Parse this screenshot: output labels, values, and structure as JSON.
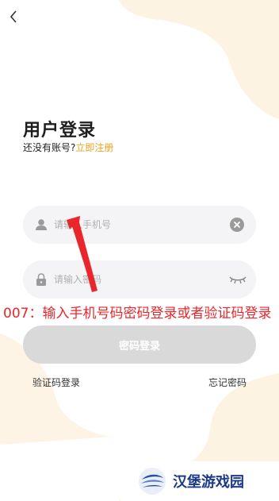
{
  "page": {
    "background": "#ffffff",
    "blob_color": "#fdf3e2"
  },
  "header": {
    "back_icon": "chevron-left-icon"
  },
  "login": {
    "title": "用户登录",
    "no_account_text": "还没有账号?",
    "register_link": "立即注册",
    "phone_placeholder": "请输入手机号",
    "phone_value": "",
    "password_placeholder": "请输入密码",
    "password_value": "",
    "submit_label": "密码登录",
    "sms_login_link": "验证码登录",
    "forgot_password_link": "忘记密码",
    "colors": {
      "accent": "#f0a11e",
      "button_disabled": "#d9d9d9",
      "field_bg": "#f4f4f6"
    }
  },
  "annotation": {
    "text": "007：输入手机号码密码登录或者验证码登录",
    "color": "#e8262b"
  },
  "watermark": {
    "text": "汉堡游戏园"
  }
}
